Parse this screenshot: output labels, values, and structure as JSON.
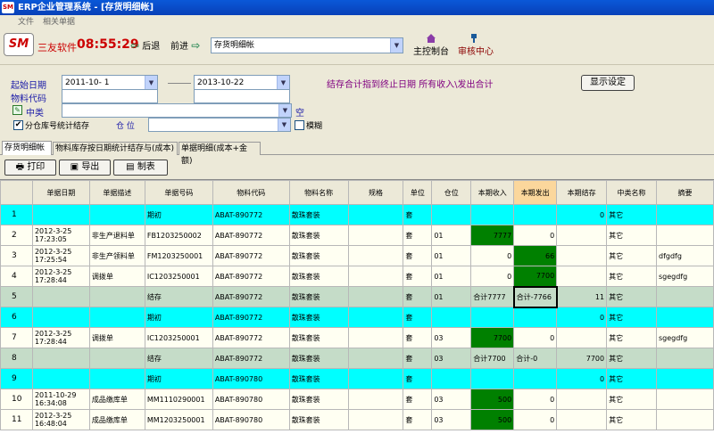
{
  "window": {
    "title": "ERP企业管理系统 - [存货明细帐]",
    "logo": "SM"
  },
  "menu": [
    "文件",
    "相关单据"
  ],
  "toolbar": {
    "brand_logo": "SM",
    "brand": "三友软件",
    "clock": "08:55:29",
    "back": "后退",
    "forward": "前进",
    "module": "存货明细帐",
    "main_console": "主控制台",
    "audit_center": "审核中心"
  },
  "filters": {
    "start_date_label": "起始日期",
    "start_date": "2011-10- 1",
    "end_date": "2013-10-22",
    "note": "结存合计指到终止日期 所有收入\\发出合计",
    "display_btn": "显示设定",
    "material_code_label": "物料代码",
    "mid_class_label": "中类",
    "empty_label": "空",
    "split_label": "分仓库号统计结存",
    "location_label": "仓  位",
    "fuzzy_label": "模糊"
  },
  "tabs": [
    "存货明细帐",
    "物料库存按日期统计结存与(成本)",
    "单据明细(成本+金额)"
  ],
  "actions": {
    "print": "打印",
    "export": "导出",
    "report": "制表"
  },
  "table": {
    "columns": [
      "",
      "单据日期",
      "单据描述",
      "单据号码",
      "物料代码",
      "物料名称",
      "规格",
      "单位",
      "仓位",
      "本期收入",
      "本期发出",
      "本期结存",
      "中类名称",
      "摘要"
    ],
    "rows": [
      {
        "n": "1",
        "type": "cyan",
        "date": "",
        "time": "",
        "desc": "",
        "no": "期初",
        "code": "ABAT-890772",
        "name": "散珠套装",
        "spec": "",
        "unit": "套",
        "loc": "",
        "in": "",
        "out": "",
        "bal": "0",
        "cls": "其它",
        "memo": ""
      },
      {
        "n": "2",
        "type": "plain",
        "date": "2012-3-25",
        "time": "17:23:05",
        "desc": "非生产退料单",
        "no": "FB1203250002",
        "code": "ABAT-890772",
        "name": "散珠套装",
        "spec": "",
        "unit": "套",
        "loc": "01",
        "in": "7777",
        "out": "0",
        "bal": "",
        "cls": "其它",
        "memo": "",
        "ing": true
      },
      {
        "n": "3",
        "type": "plain",
        "date": "2012-3-25",
        "time": "17:25:54",
        "desc": "非生产领料单",
        "no": "FM1203250001",
        "code": "ABAT-890772",
        "name": "散珠套装",
        "spec": "",
        "unit": "套",
        "loc": "01",
        "in": "0",
        "out": "66",
        "bal": "",
        "cls": "其它",
        "memo": "dfgdfg",
        "outg": true
      },
      {
        "n": "4",
        "type": "plain",
        "date": "2012-3-25",
        "time": "17:28:44",
        "desc": "调拨单",
        "no": "IC1203250001",
        "code": "ABAT-890772",
        "name": "散珠套装",
        "spec": "",
        "unit": "套",
        "loc": "01",
        "in": "0",
        "out": "7700",
        "bal": "",
        "cls": "其它",
        "memo": "sgegdfg",
        "outg": true
      },
      {
        "n": "5",
        "type": "sum",
        "date": "",
        "time": "",
        "desc": "",
        "no": "结存",
        "code": "ABAT-890772",
        "name": "散珠套装",
        "spec": "",
        "unit": "套",
        "loc": "01",
        "in": "合计7777",
        "out": "合计-7766",
        "bal": "11",
        "cls": "其它",
        "memo": "",
        "sel": true
      },
      {
        "n": "6",
        "type": "cyan",
        "date": "",
        "time": "",
        "desc": "",
        "no": "期初",
        "code": "ABAT-890772",
        "name": "散珠套装",
        "spec": "",
        "unit": "套",
        "loc": "",
        "in": "",
        "out": "",
        "bal": "0",
        "cls": "其它",
        "memo": ""
      },
      {
        "n": "7",
        "type": "plain",
        "date": "2012-3-25",
        "time": "17:28:44",
        "desc": "调拨单",
        "no": "IC1203250001",
        "code": "ABAT-890772",
        "name": "散珠套装",
        "spec": "",
        "unit": "套",
        "loc": "03",
        "in": "7700",
        "out": "0",
        "bal": "",
        "cls": "其它",
        "memo": "sgegdfg",
        "ing": true
      },
      {
        "n": "8",
        "type": "sum",
        "date": "",
        "time": "",
        "desc": "",
        "no": "结存",
        "code": "ABAT-890772",
        "name": "散珠套装",
        "spec": "",
        "unit": "套",
        "loc": "03",
        "in": "合计7700",
        "out": "合计-0",
        "bal": "7700",
        "cls": "其它",
        "memo": ""
      },
      {
        "n": "9",
        "type": "cyan",
        "date": "",
        "time": "",
        "desc": "",
        "no": "期初",
        "code": "ABAT-890780",
        "name": "散珠套装",
        "spec": "",
        "unit": "套",
        "loc": "",
        "in": "",
        "out": "",
        "bal": "0",
        "cls": "其它",
        "memo": ""
      },
      {
        "n": "10",
        "type": "plain",
        "date": "2011-10-29",
        "time": "16:34:08",
        "desc": "成品缴库单",
        "no": "MM1110290001",
        "code": "ABAT-890780",
        "name": "散珠套装",
        "spec": "",
        "unit": "套",
        "loc": "03",
        "in": "500",
        "out": "0",
        "bal": "",
        "cls": "其它",
        "memo": "",
        "ing": true
      },
      {
        "n": "11",
        "type": "plain",
        "date": "2012-3-25",
        "time": "16:48:04",
        "desc": "成品缴库单",
        "no": "MM1203250001",
        "code": "ABAT-890780",
        "name": "散珠套装",
        "spec": "",
        "unit": "套",
        "loc": "03",
        "in": "500",
        "out": "0",
        "bal": "",
        "cls": "其它",
        "memo": "",
        "ing": true
      }
    ]
  }
}
